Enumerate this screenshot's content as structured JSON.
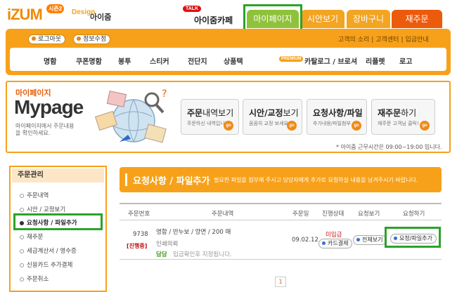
{
  "logo": {
    "brand": "iZUM",
    "badge": "시즌2",
    "design": "Design",
    "name": "아이줌"
  },
  "cafe": {
    "talk": "TALK",
    "name": "아이줌카페"
  },
  "top_tabs": [
    {
      "label": "마이페이지",
      "color": "#8fc23b"
    },
    {
      "label": "시안보기",
      "color": "#f3a421"
    },
    {
      "label": "장바구니",
      "color": "#f3a421"
    },
    {
      "label": "재주문",
      "color": "#ec5a0c"
    }
  ],
  "account": {
    "logout": "로그아웃",
    "edit_info": "정보수정"
  },
  "top_links": [
    "고객의 소리",
    "고객센터",
    "입금안내"
  ],
  "menu": {
    "items": [
      "명함",
      "쿠폰명함",
      "봉투",
      "스티커",
      "전단지",
      "상품택"
    ],
    "premium_badge": "PREMIUM",
    "premium_items": [
      "카탈로그 / 브로셔",
      "리플렛",
      "로고"
    ]
  },
  "mypage": {
    "title_kr": "마이페이지",
    "title_en": "Mypage",
    "desc": "마이페이지에서 주문내용을 확인하세요.",
    "buttons": [
      {
        "title": "주문",
        "title_sub": "내역보기",
        "desc": "주문하신 내역입니다",
        "go": "go"
      },
      {
        "title": "시안/교정",
        "title_sub": "보기",
        "desc": "꼼꼼히 교정 보세요!",
        "go": "go"
      },
      {
        "title": "요청사항/파일",
        "title_sub": "",
        "desc": "추가내용/파일첨부",
        "go": "go"
      },
      {
        "title": "재주문",
        "title_sub": "하기",
        "desc": "재주문 고객님 클릭!",
        "go": "go"
      }
    ],
    "hours": "* 아이줌 근무시간은 09:00~19:00 입니다."
  },
  "sidebar": {
    "title": "주문관리",
    "items": [
      "주문내역",
      "시안 / 교정보기",
      "요청사항 / 파일추가",
      "재주문",
      "세금계산서 / 영수증",
      "신용카드 추가결제",
      "주문취소"
    ],
    "selected_index": 2
  },
  "panel": {
    "title": "요청사항 / 파일추가",
    "desc": "필요한 파일을 첨부해 주시고 담당자에게 추가로 요청하실 내용을 남겨주시기 바랍니다."
  },
  "table": {
    "headers": [
      "주문번호",
      "주문내역",
      "주문일",
      "진행상태",
      "요청보기",
      "요청하기"
    ],
    "row": {
      "order_no": "9738",
      "status_badge": "[진행중]",
      "item_desc": "명함 / 반누보 / 양면 / 200 매",
      "item_note": "인쇄의뢰",
      "manager_label": "담당",
      "manager_value": "입금확인후 지정됩니다.",
      "order_date": "09.02.12",
      "state": "미입금",
      "pay_button": "카드결제",
      "view_button": "전체보기",
      "add_button": "요청/파일추가"
    }
  },
  "pager": {
    "current": "1"
  }
}
